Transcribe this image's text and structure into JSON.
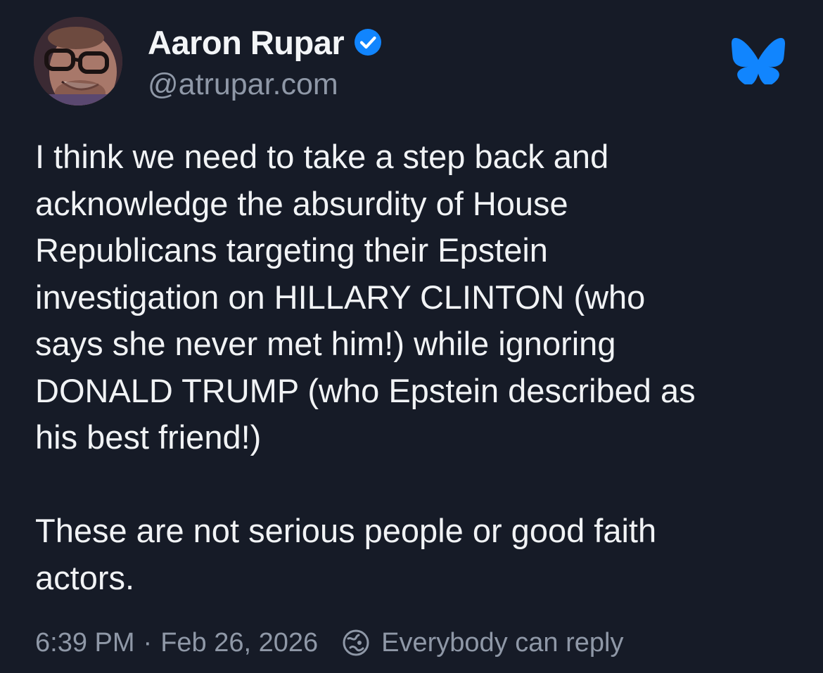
{
  "author": {
    "display_name": "Aaron Rupar",
    "handle": "@atrupar.com",
    "verified": true
  },
  "post": {
    "paragraph_1_lines": [
      "I think we need to take a step back and",
      "acknowledge the absurdity of House",
      "Republicans targeting their Epstein",
      "investigation on HILLARY CLINTON (who",
      "says she never met him!) while ignoring",
      "DONALD TRUMP (who Epstein described as",
      "his best friend!)"
    ],
    "paragraph_2_lines": [
      "These are not serious people or good faith",
      "actors."
    ]
  },
  "meta": {
    "time": "6:39 PM",
    "separator": "·",
    "date": "Feb 26, 2026",
    "reply_setting": "Everybody can reply"
  },
  "icons": {
    "verified": "verified-check-icon",
    "platform_logo": "bluesky-butterfly-icon",
    "reply_setting": "globe-icon"
  },
  "colors": {
    "background": "#161b27",
    "text_primary": "#f1f3f5",
    "text_secondary": "#8f98a7",
    "accent_blue": "#1185fe"
  }
}
